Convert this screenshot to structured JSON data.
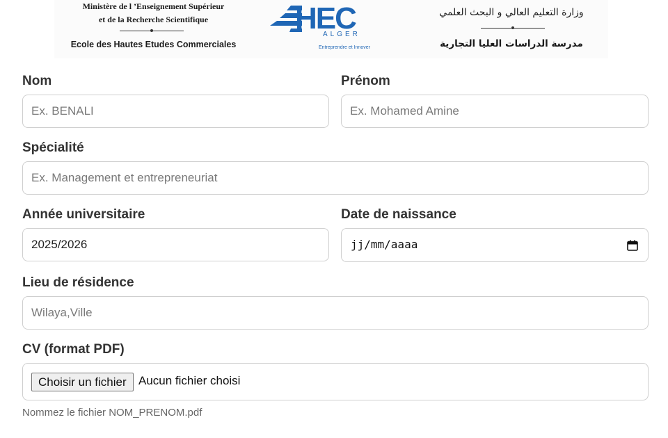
{
  "banner": {
    "ministry_fr_line1": "Ministère de l ’Enseignement Supérieur",
    "ministry_fr_line2": "et de la Recherche Scientifique",
    "school_fr": "Ecole des Hautes Etudes Commerciales",
    "logo_word": "HEC",
    "logo_city": "ALGER",
    "logo_tagline": "Entreprendre et Innover",
    "ministry_ar": "وزارة التعليم العالي و البحث العلمي",
    "school_ar": "مدرسة الدراسات العليا التجارية",
    "brand_color": "#1f66b5"
  },
  "form": {
    "nom": {
      "label": "Nom",
      "placeholder": "Ex. BENALI"
    },
    "prenom": {
      "label": "Prénom",
      "placeholder": "Ex. Mohamed Amine"
    },
    "specialite": {
      "label": "Spécialité",
      "placeholder": "Ex. Management et entrepreneuriat"
    },
    "annee": {
      "label": "Année universitaire",
      "value": "2025/2026"
    },
    "naissance": {
      "label": "Date de naissance",
      "placeholder": "jj/mm/aaaa",
      "icon": "calendar-icon"
    },
    "residence": {
      "label": "Lieu de résidence",
      "placeholder": "Wilaya,Ville"
    },
    "cv": {
      "label": "CV (format PDF)",
      "button_label": "Choisir un fichier",
      "status": "Aucun fichier choisi",
      "hint": "Nommez le fichier NOM_PRENOM.pdf"
    }
  }
}
